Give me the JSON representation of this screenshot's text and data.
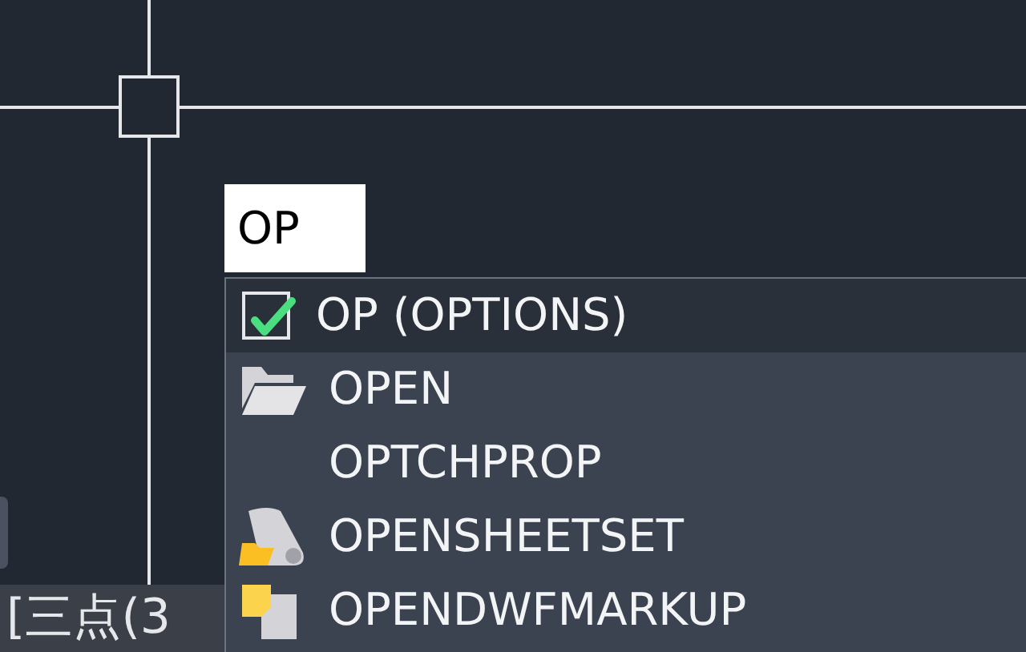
{
  "command_input": {
    "value": "OP"
  },
  "suggestions": [
    {
      "label": "OP (OPTIONS)",
      "kind": "check",
      "selected": true
    },
    {
      "label": "OPEN",
      "kind": "folder",
      "selected": false
    },
    {
      "label": "OPTCHPROP",
      "kind": "none",
      "selected": false
    },
    {
      "label": "OPENSHEETSET",
      "kind": "sheetset",
      "selected": false
    },
    {
      "label": "OPENDWFMARKUP",
      "kind": "markup",
      "selected": false
    }
  ],
  "command_line": {
    "text": "[三点(3"
  }
}
